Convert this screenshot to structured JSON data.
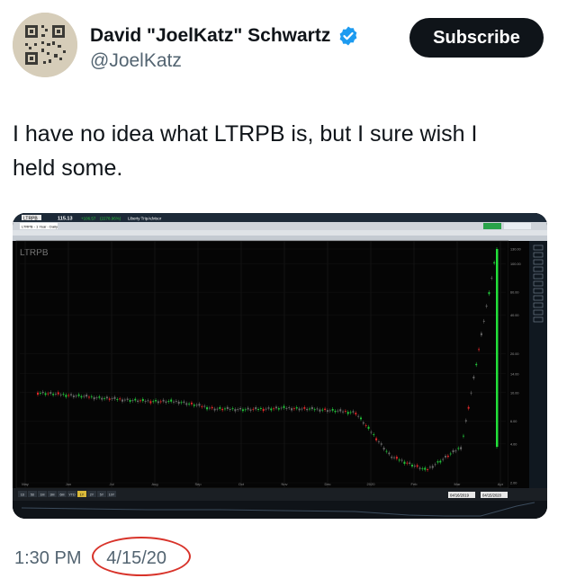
{
  "author": {
    "display_name": "David \"JoelKatz\" Schwartz",
    "handle": "@JoelKatz",
    "avatar_icon": "qr-code-avatar",
    "verified_icon": "verified-badge-icon",
    "verified_color": "#1d9bf0"
  },
  "subscribe_label": "Subscribe",
  "tweet": {
    "line1": "I have no idea what LTRPB is, but I sure wish I",
    "line2": "held some."
  },
  "timestamp": {
    "time": "1:30 PM",
    "separator": "·",
    "date": "4/15/20",
    "annotation_color": "#d8332a"
  },
  "chart_window": {
    "symbol": "LTRPB",
    "price": "115.13",
    "change": "+106.57",
    "change_pct": "(2278.96%)",
    "company": "Liberty TripAdvisor",
    "tab": "LTRPB - 1 Year - Daily",
    "chart_title": "LTRPB",
    "x_tick_labels": [
      "May",
      "Jun",
      "Jul",
      "Aug",
      "Sep",
      "Oct",
      "Nov",
      "Dec",
      "2020",
      "Feb",
      "Mar",
      "Apr"
    ],
    "y_tick_labels": [
      "130.00",
      "100.00",
      "60.00",
      "40.00",
      "20.00",
      "14.00",
      "10.00",
      "6.00",
      "4.00",
      "2.00"
    ],
    "range_buttons": [
      "1D",
      "5D",
      "1M",
      "3M",
      "6M",
      "YTD",
      "1Y",
      "2Y",
      "5Y",
      "10Y"
    ],
    "date_from": "04/16/2019",
    "date_to": "04/15/2020"
  },
  "chart_data": {
    "type": "candlestick",
    "title": "LTRPB",
    "y_scale": "log",
    "x": [
      "May",
      "Jun",
      "Jul",
      "Aug",
      "Sep",
      "Oct",
      "Nov",
      "Dec",
      "2020",
      "Feb",
      "Mar",
      "Apr"
    ],
    "series": [
      {
        "values": [
          10,
          9.5,
          9,
          8.6,
          8.5,
          7.5,
          7.4,
          7.6,
          7.4,
          7,
          3.2,
          2.5,
          3.8,
          130
        ]
      }
    ]
  }
}
